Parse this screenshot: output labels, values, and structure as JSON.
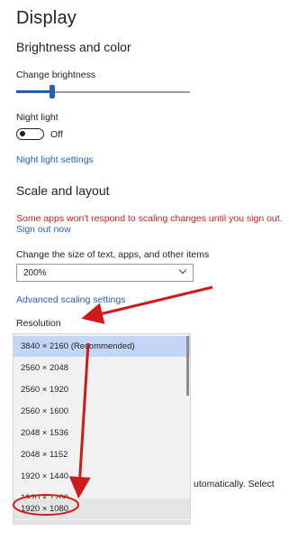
{
  "header": {
    "title": "Display"
  },
  "brightness": {
    "section_title": "Brightness and color",
    "label": "Change brightness",
    "value_percent": 22
  },
  "night_light": {
    "label": "Night light",
    "state_text": "Off",
    "settings_link": "Night light settings"
  },
  "scale_layout": {
    "section_title": "Scale and layout",
    "warning": "Some apps won't respond to scaling changes until you sign out.",
    "sign_out_link": "Sign out now",
    "size_label": "Change the size of text, apps, and other items",
    "size_value": "200%",
    "advanced_link": "Advanced scaling settings"
  },
  "resolution": {
    "label": "Resolution",
    "options": [
      {
        "label": "3840 × 2160 (Recommended)",
        "selected": true
      },
      {
        "label": "2560 × 2048"
      },
      {
        "label": "2560 × 1920"
      },
      {
        "label": "2560 × 1600"
      },
      {
        "label": "2048 × 1536"
      },
      {
        "label": "2048 × 1152"
      },
      {
        "label": "1920 × 1440"
      },
      {
        "label": "1920 × 1200"
      },
      {
        "label": "1920 × 1080",
        "circled": true
      }
    ]
  },
  "overflow_text": "utomatically. Select",
  "colors": {
    "accent": "#1f5fb4",
    "link": "#2a5fb4",
    "warning": "#cc2020",
    "annotation": "#d01a1a"
  }
}
